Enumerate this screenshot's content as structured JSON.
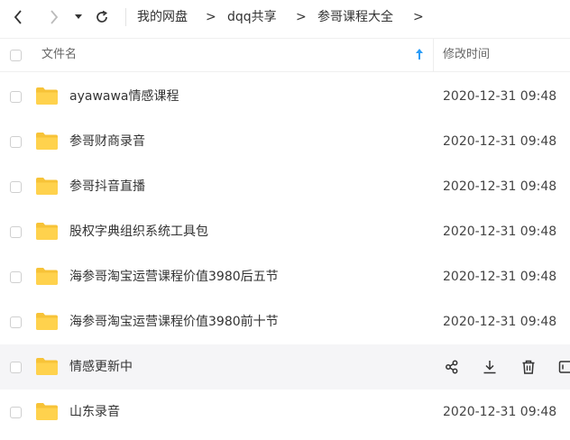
{
  "toolbar": {
    "breadcrumbs": [
      {
        "label": "我的网盘"
      },
      {
        "label": "dqq共享"
      },
      {
        "label": "参哥课程大全"
      }
    ],
    "separator": ">"
  },
  "header": {
    "name_label": "文件名",
    "modified_label": "修改时间",
    "sort_color": "#2a9cf7"
  },
  "files": [
    {
      "name": "ayawawa情感课程",
      "modified": "2020-12-31 09:48"
    },
    {
      "name": "参哥财商录音",
      "modified": "2020-12-31 09:48"
    },
    {
      "name": "参哥抖音直播",
      "modified": "2020-12-31 09:48"
    },
    {
      "name": "股权字典组织系统工具包",
      "modified": "2020-12-31 09:48"
    },
    {
      "name": "海参哥淘宝运营课程价值3980后五节",
      "modified": "2020-12-31 09:48"
    },
    {
      "name": "海参哥淘宝运营课程价值3980前十节",
      "modified": "2020-12-31 09:48"
    },
    {
      "name": "情感更新中",
      "modified": ""
    },
    {
      "name": "山东录音",
      "modified": "2020-12-31 09:48"
    }
  ],
  "hover_row_actions": [
    "share-icon",
    "download-icon",
    "delete-icon",
    "more-icon"
  ],
  "colors": {
    "folder": "#ffd24d",
    "folder_tab": "#f7c338",
    "hover_row": "#f5f5f7"
  }
}
